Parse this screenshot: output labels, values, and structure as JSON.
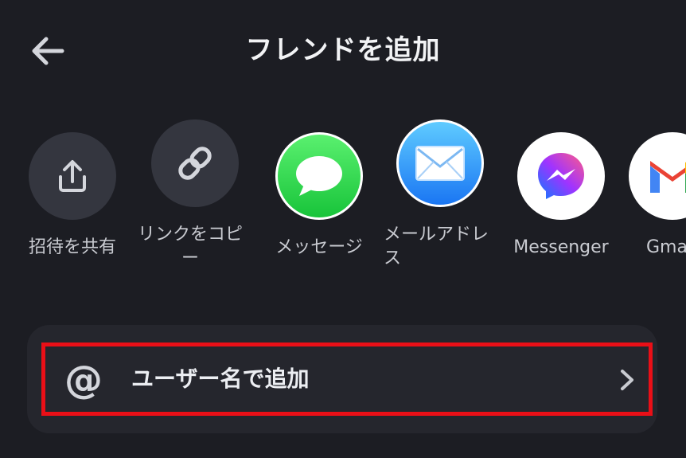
{
  "header": {
    "title": "フレンドを追加",
    "back_icon": "arrow-left-icon"
  },
  "share_options": [
    {
      "label": "招待を共有",
      "icon": "share-upload-icon"
    },
    {
      "label": "リンクをコピー",
      "icon": "link-icon"
    },
    {
      "label": "メッセージ",
      "icon": "messages-icon"
    },
    {
      "label": "メールアドレス",
      "icon": "mail-icon"
    },
    {
      "label": "Messenger",
      "icon": "messenger-icon"
    },
    {
      "label": "Gmail",
      "icon": "gmail-icon"
    }
  ],
  "add_by_username": {
    "icon": "at-sign-icon",
    "at_symbol": "@",
    "label": "ユーザー名で追加",
    "chevron": "chevron-right-icon",
    "highlight_color": "#ea0f17"
  },
  "colors": {
    "background": "#1c1d23",
    "card": "#25262d",
    "dark_circle": "#34363f"
  }
}
